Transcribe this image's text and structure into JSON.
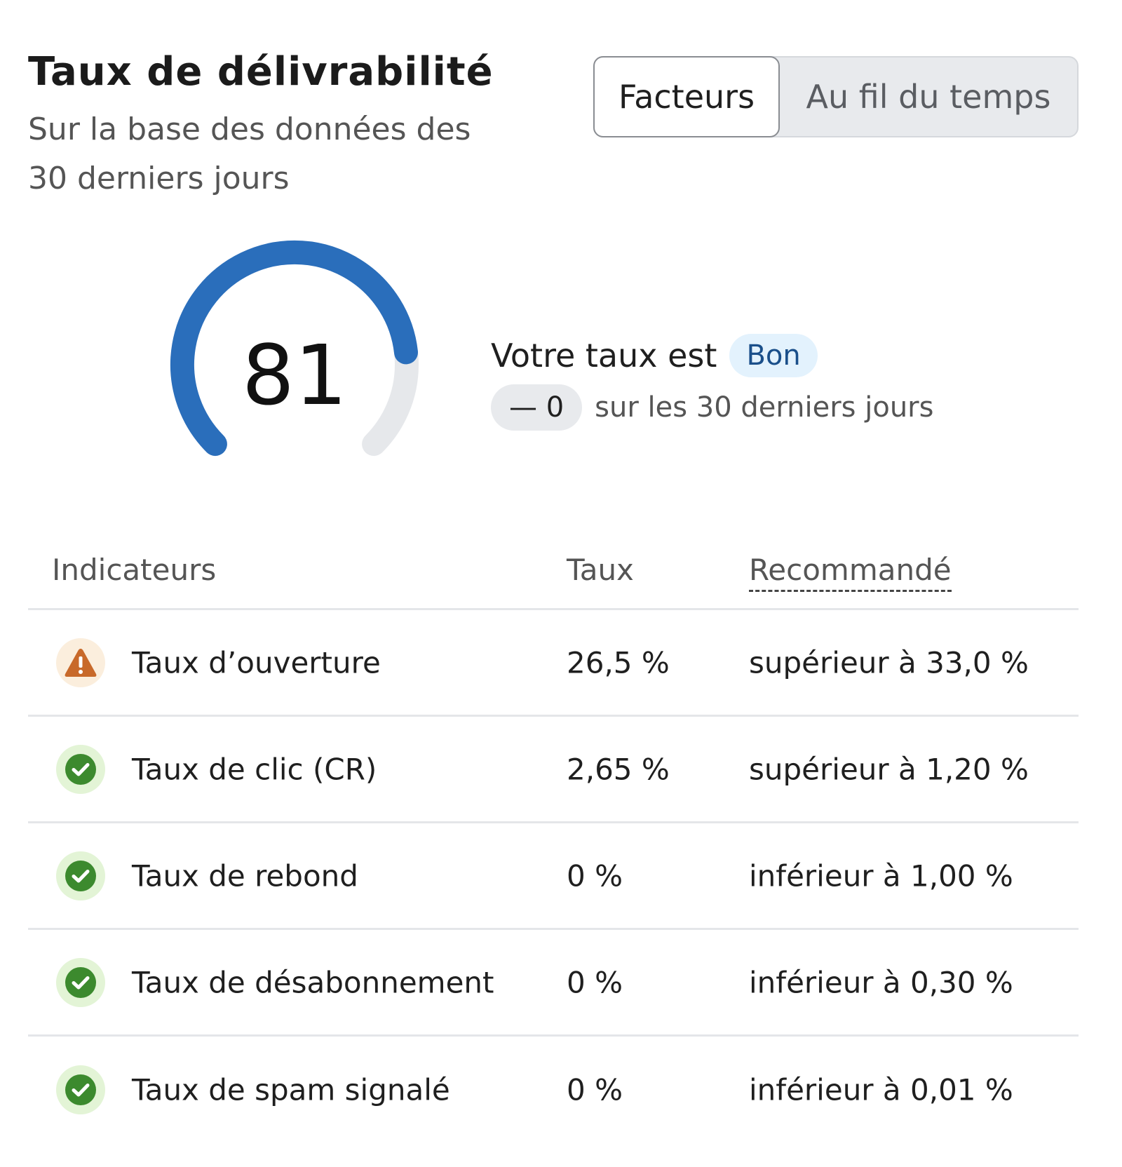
{
  "header": {
    "title": "Taux de délivrabilité",
    "subtitle": "Sur la base des données des 30 derniers jours"
  },
  "view_toggle": {
    "options": [
      "Facteurs",
      "Au fil du temps"
    ],
    "selected": "Facteurs"
  },
  "score": {
    "value": "81",
    "gauge_fraction": 0.81,
    "status_prefix": "Votre taux est",
    "status_badge": "Bon",
    "change_value": "— 0",
    "change_period": "sur les 30 derniers jours"
  },
  "table": {
    "columns": [
      "Indicateurs",
      "Taux",
      "Recommandé"
    ],
    "rows": [
      {
        "icon": "warning-icon",
        "indicator": "Taux d’ouverture",
        "rate": "26,5 %",
        "recommended": "supérieur à 33,0 %"
      },
      {
        "icon": "check-circle-icon",
        "indicator": "Taux de clic (CR)",
        "rate": "2,65 %",
        "recommended": "supérieur à 1,20 %"
      },
      {
        "icon": "check-circle-icon",
        "indicator": "Taux de rebond",
        "rate": "0 %",
        "recommended": "inférieur à 1,00 %"
      },
      {
        "icon": "check-circle-icon",
        "indicator": "Taux de désabonnement",
        "rate": "0 %",
        "recommended": "inférieur à 0,30 %"
      },
      {
        "icon": "check-circle-icon",
        "indicator": "Taux de spam signalé",
        "rate": "0 %",
        "recommended": "inférieur à 0,01 %"
      }
    ]
  },
  "colors": {
    "gauge_fill": "#2a6ebb",
    "gauge_track": "#e6e8eb",
    "ok": "#3c8a2e",
    "warn": "#c8692a"
  }
}
